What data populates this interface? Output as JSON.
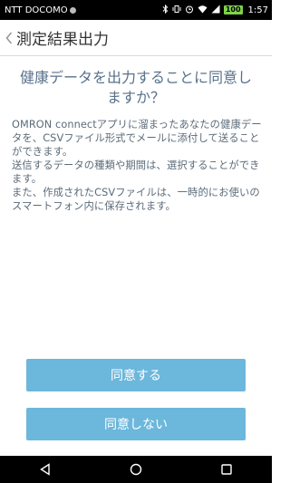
{
  "status_bar": {
    "carrier": "NTT DOCOMO",
    "battery": "100",
    "time": "1:57",
    "icons": [
      "bluetooth-icon",
      "vibrate-icon",
      "alarm-icon",
      "wifi-icon",
      "signal-icon",
      "battery-icon"
    ]
  },
  "header": {
    "title": "測定結果出力",
    "back_icon": "chevron-left-icon"
  },
  "main": {
    "headline": "健康データを出力することに同意しますか？",
    "description": "OMRON connectアプリに溜まったあなたの健康データを、CSVファイル形式でメールに添付して送ることができます。\n送信するデータの種類や期間は、選択することができます。\nまた、作成されたCSVファイルは、一時的にお使いのスマートフォン内に保存されます。"
  },
  "buttons": {
    "agree": "同意する",
    "disagree": "同意しない"
  },
  "nav_bar": {
    "icons": [
      "back-triangle-icon",
      "home-circle-icon",
      "recents-square-icon"
    ]
  },
  "colors": {
    "button": "#6cb7dc",
    "headline": "#58718a",
    "text": "#5b6b79"
  }
}
